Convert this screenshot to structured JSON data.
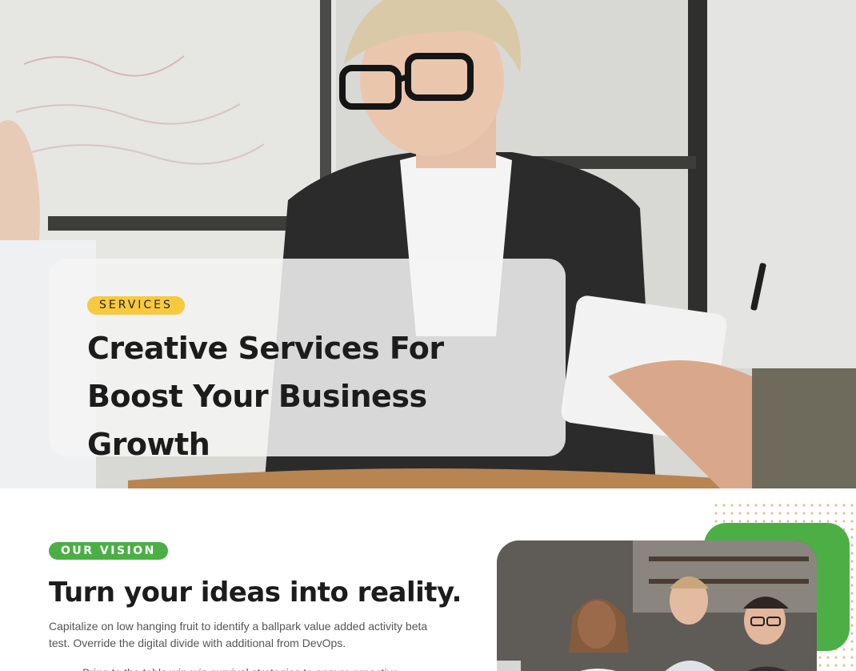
{
  "hero": {
    "badge": "SERVICES",
    "title": "Creative Services For Boost Your Business Growth"
  },
  "vision": {
    "badge": "OUR VISION",
    "title": "Turn your ideas into reality.",
    "text": "Capitalize on low hanging fruit to identify a ballpark value added activity beta test. Override the digital divide with additional from DevOps.",
    "list": [
      "Bring to the table win-win survival strategies to ensure proactive"
    ]
  },
  "colors": {
    "services_badge": "#f7c93e",
    "vision_badge": "#4caf45",
    "green_frame": "#4caf45"
  }
}
